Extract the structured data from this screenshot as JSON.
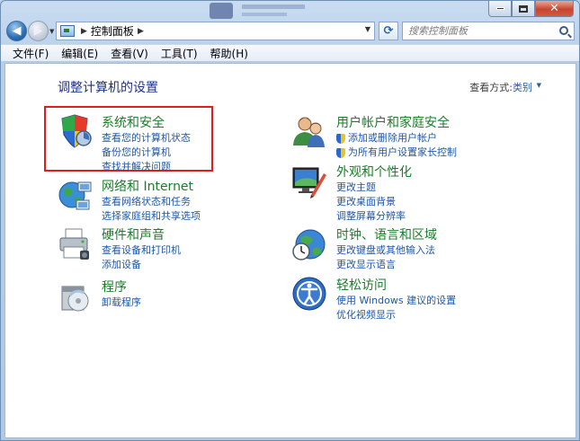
{
  "window": {
    "controls": {
      "minimize": "minimize",
      "maximize": "maximize",
      "close": "close"
    }
  },
  "navigation": {
    "address_crumb": "控制面板",
    "search_placeholder": "搜索控制面板"
  },
  "menu": [
    "文件(F)",
    "编辑(E)",
    "查看(V)",
    "工具(T)",
    "帮助(H)"
  ],
  "page": {
    "heading": "调整计算机的设置",
    "view_by_label": "查看方式:",
    "view_by_value": "类别"
  },
  "categories": {
    "system_security": {
      "title": "系统和安全",
      "links": [
        "查看您的计算机状态",
        "备份您的计算机",
        "查找并解决问题"
      ],
      "icon": "shield-icon"
    },
    "network": {
      "title": "网络和 Internet",
      "links": [
        "查看网络状态和任务",
        "选择家庭组和共享选项"
      ],
      "icon": "globe-network-icon"
    },
    "hardware": {
      "title": "硬件和声音",
      "links": [
        "查看设备和打印机",
        "添加设备"
      ],
      "icon": "printer-icon"
    },
    "programs": {
      "title": "程序",
      "links": [
        "卸载程序"
      ],
      "icon": "programs-icon"
    },
    "user_accounts": {
      "title": "用户帐户和家庭安全",
      "links": [
        "添加或删除用户帐户",
        "为所有用户设置家长控制"
      ],
      "icon": "users-icon"
    },
    "appearance": {
      "title": "外观和个性化",
      "links": [
        "更改主题",
        "更改桌面背景",
        "调整屏幕分辨率"
      ],
      "icon": "monitor-icon"
    },
    "clock": {
      "title": "时钟、语言和区域",
      "links": [
        "更改键盘或其他输入法",
        "更改显示语言"
      ],
      "icon": "clock-globe-icon"
    },
    "ease": {
      "title": "轻松访问",
      "links": [
        "使用 Windows 建议的设置",
        "优化视频显示"
      ],
      "icon": "accessibility-icon"
    }
  },
  "colors": {
    "category_title": "#1a7d28",
    "link": "#1f57a7",
    "heading": "#1e3287",
    "highlight": "#e11d1d"
  }
}
